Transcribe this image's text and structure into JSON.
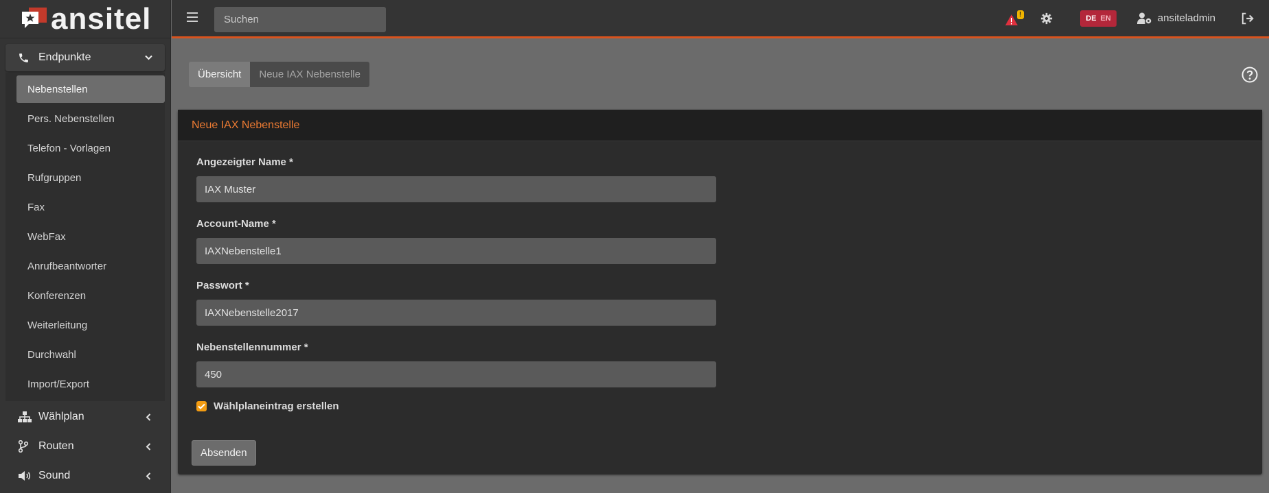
{
  "brand": {
    "name": "ansitel"
  },
  "sidebar": {
    "groups": [
      {
        "label": "Endpunkte",
        "icon": "phone-icon",
        "expanded": true,
        "items": [
          {
            "label": "Nebenstellen",
            "active": true
          },
          {
            "label": "Pers. Nebenstellen"
          },
          {
            "label": "Telefon - Vorlagen"
          },
          {
            "label": "Rufgruppen"
          },
          {
            "label": "Fax"
          },
          {
            "label": "WebFax"
          },
          {
            "label": "Anrufbeantworter"
          },
          {
            "label": "Konferenzen"
          },
          {
            "label": "Weiterleitung"
          },
          {
            "label": "Durchwahl"
          },
          {
            "label": "Import/Export"
          }
        ]
      },
      {
        "label": "Wählplan",
        "icon": "sitemap-icon",
        "expanded": false
      },
      {
        "label": "Routen",
        "icon": "code-branch-icon",
        "expanded": false
      },
      {
        "label": "Sound",
        "icon": "volume-icon",
        "expanded": false
      }
    ]
  },
  "topbar": {
    "search_placeholder": "Suchen",
    "alert_count": "!",
    "lang_de": "DE",
    "lang_en": "EN",
    "username": "ansiteladmin"
  },
  "tabs": [
    {
      "label": "Übersicht",
      "active": true
    },
    {
      "label": "Neue IAX Nebenstelle",
      "active": false
    }
  ],
  "form": {
    "title": "Neue IAX Nebenstelle",
    "fields": [
      {
        "label": "Angezeigter Name *",
        "value": "IAX Muster"
      },
      {
        "label": "Account-Name *",
        "value": "IAXNebenstelle1"
      },
      {
        "label": "Passwort *",
        "value": "IAXNebenstelle2017"
      },
      {
        "label": "Nebenstellennummer *",
        "value": "450"
      }
    ],
    "checkbox_label": "Wählplaneintrag erstellen",
    "checkbox_checked": true,
    "submit_label": "Absenden"
  },
  "colors": {
    "accent_orange": "#ef7c33",
    "topbar_border": "#d9531e",
    "checkbox": "#f39c12",
    "alert_red": "#e0303e",
    "alert_badge": "#f0b400",
    "lang_bg": "#b3273a"
  }
}
